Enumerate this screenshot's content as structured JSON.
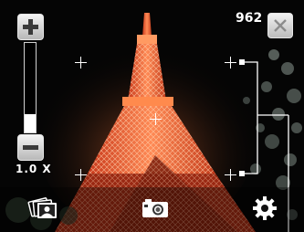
{
  "zoom": {
    "label": "1.0 X",
    "level": 0.2
  },
  "status": {
    "shots_remaining": "962"
  },
  "toolbar": {
    "items": [
      {
        "icon": "photo-gallery-icon"
      },
      {
        "icon": "camera-icon"
      },
      {
        "icon": "gear-icon"
      }
    ]
  },
  "colors": {
    "tower": "#e8552a",
    "tower_light": "#ff9966",
    "background": "#050505",
    "foliage": "#8a9890"
  }
}
